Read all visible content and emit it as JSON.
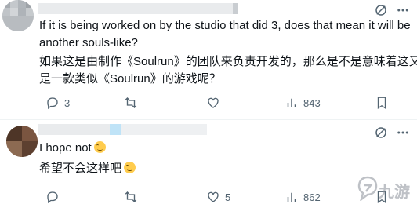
{
  "tweets": [
    {
      "text_lines": [
        "If it is being worked on by the studio that did 3, does that mean it will be",
        "another souls-like?",
        "如果这是由制作《Soulrun》的团队来负责开发的，那么是不是意味着这又会",
        "是一款类似《Soulrun》的游戏呢？"
      ],
      "stats": {
        "replies": "3",
        "retweets": "",
        "likes": "",
        "views": "843"
      },
      "icons": [
        "grok-icon",
        "more-icon",
        "reply-icon",
        "retweet-icon",
        "like-icon",
        "views-icon",
        "bookmark-icon"
      ]
    },
    {
      "text_lines": [
        "I hope not",
        "希望不会这样吧"
      ],
      "stats": {
        "replies": "",
        "retweets": "",
        "likes": "5",
        "views": "862"
      },
      "icons": [
        "grok-icon",
        "more-icon",
        "reply-icon",
        "retweet-icon",
        "like-icon",
        "views-icon",
        "bookmark-icon"
      ]
    }
  ],
  "watermark": {
    "label": "九游"
  },
  "colors": {
    "text": "#0f1419",
    "muted": "#536471",
    "divider": "#eff3f4"
  }
}
